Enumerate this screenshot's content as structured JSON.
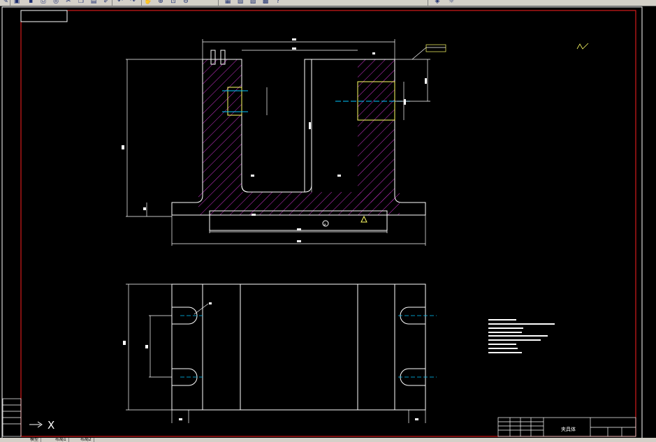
{
  "toolbar": {
    "buttons": [
      {
        "name": "new-icon",
        "glyph": "✎"
      },
      {
        "name": "open-icon",
        "glyph": "▣"
      },
      {
        "name": "save-icon",
        "glyph": "▪"
      },
      {
        "name": "print-icon",
        "glyph": "⎙"
      },
      {
        "name": "preview-icon",
        "glyph": "◎"
      },
      {
        "name": "cut-icon",
        "glyph": "✂"
      },
      {
        "name": "copy-icon",
        "glyph": "❐"
      },
      {
        "name": "paste-icon",
        "glyph": "▤"
      },
      {
        "name": "match-properties-icon",
        "glyph": "✐"
      },
      {
        "name": "undo-icon",
        "glyph": "↶"
      },
      {
        "name": "redo-icon",
        "glyph": "↷"
      },
      {
        "name": "pan-icon",
        "glyph": "✋"
      },
      {
        "name": "zoom-realtime-icon",
        "glyph": "⊕"
      },
      {
        "name": "zoom-window-icon",
        "glyph": "⊡"
      },
      {
        "name": "zoom-previous-icon",
        "glyph": "⊖"
      },
      {
        "name": "properties-icon",
        "glyph": "▦"
      },
      {
        "name": "design-center-icon",
        "glyph": "▧"
      },
      {
        "name": "tool-palette-icon",
        "glyph": "▨"
      },
      {
        "name": "calculator-icon",
        "glyph": "▩"
      },
      {
        "name": "help-icon",
        "glyph": "?"
      },
      {
        "name": "layer-icon",
        "glyph": "◈"
      },
      {
        "name": "layer-state-icon",
        "glyph": "☼"
      }
    ]
  },
  "drawing": {
    "title_block_name": "夹具体",
    "callout_symbol": "⌀"
  },
  "layout_tabs": [
    "模型",
    "布局1",
    "布局2"
  ],
  "colors": {
    "background": "#000000",
    "border_red": "#ff2020",
    "line_white": "#ffffff",
    "hatch_magenta": "#cc33cc",
    "center_cyan": "#00c8ff",
    "highlight_yellow": "#ffff66",
    "toolbar_gray": "#d4d0c8"
  }
}
